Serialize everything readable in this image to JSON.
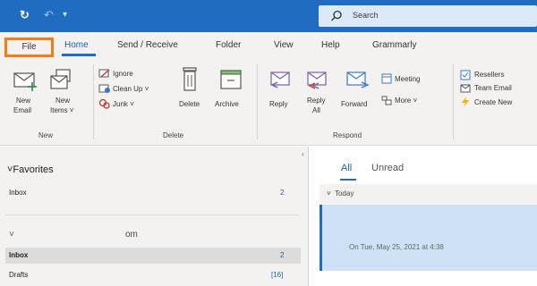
{
  "titlebar": {
    "search_placeholder": "Search",
    "icons": [
      "refresh-icon",
      "undo-icon",
      "customize-quick-access-icon",
      "search-icon"
    ]
  },
  "tabs": {
    "file": "File",
    "home": "Home",
    "send_receive": "Send / Receive",
    "folder": "Folder",
    "view": "View",
    "help": "Help",
    "grammarly": "Grammarly"
  },
  "ribbon": {
    "new_email": [
      "New",
      "Email"
    ],
    "new_items": [
      "New",
      "Items ˅"
    ],
    "ignore": "Ignore",
    "clean_up": "Clean Up ˅",
    "junk": "Junk ˅",
    "delete": "Delete",
    "archive": "Archive",
    "reply": "Reply",
    "reply_all": [
      "Reply",
      "All"
    ],
    "forward": "Forward",
    "meeting": "Meeting",
    "more": "More ˅",
    "resellers": "Resellers",
    "team_email": "Team Email",
    "create_new": "Create New",
    "groups": {
      "new": "New",
      "delete": "Delete",
      "respond": "Respond"
    }
  },
  "folders": {
    "favorites_header": "˅Favorites",
    "favorites_inbox": "Inbox",
    "favorites_inbox_count": "2",
    "account_chevron": "˅",
    "account_name_fragment": "om",
    "inbox": "Inbox",
    "inbox_count": "2",
    "drafts": "Drafts",
    "drafts_count": "[16]"
  },
  "message_list": {
    "tab_all": "All",
    "tab_unread": "Unread",
    "group_today": "˅  Today",
    "item_preview": "On Tue, May 25, 2021 at 4:38"
  },
  "colors": {
    "titlebar": "#1f6cc0",
    "accent": "#1f6cc0",
    "file_highlight": "#f07c1a",
    "selected_item": "#cfe2f5"
  }
}
